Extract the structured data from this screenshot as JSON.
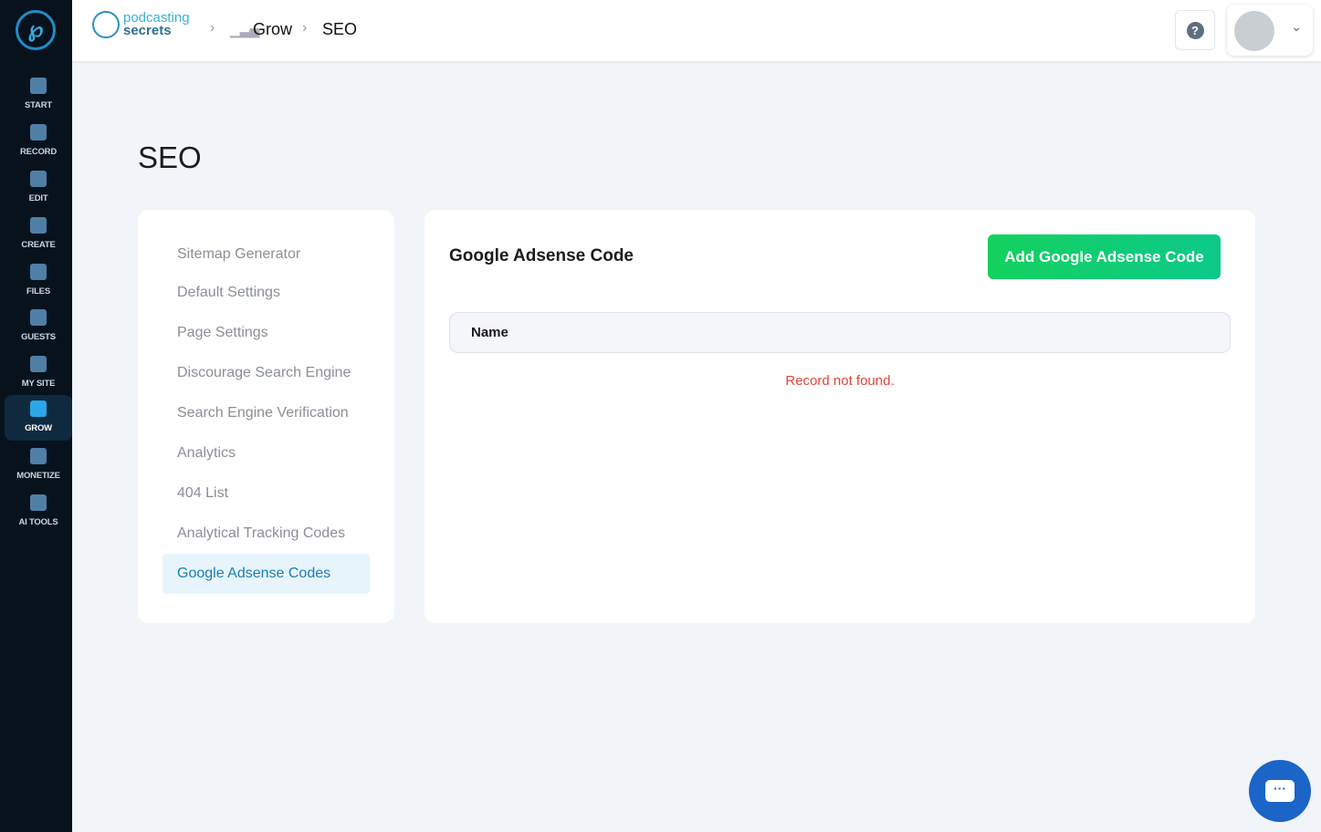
{
  "sidebar": {
    "items": [
      {
        "label": "START"
      },
      {
        "label": "RECORD"
      },
      {
        "label": "EDIT"
      },
      {
        "label": "CREATE"
      },
      {
        "label": "FILES"
      },
      {
        "label": "GUESTS"
      },
      {
        "label": "MY SITE"
      },
      {
        "label": "GROW"
      },
      {
        "label": "MONETIZE"
      },
      {
        "label": "AI TOOLS"
      }
    ],
    "active": "GROW"
  },
  "header": {
    "brand_top": "podcasting",
    "brand_bottom": "secrets",
    "breadcrumb": [
      "Grow",
      "SEO"
    ],
    "help": "?"
  },
  "page": {
    "title": "SEO"
  },
  "menu": {
    "items": [
      {
        "label": "Sitemap Generator"
      },
      {
        "label": "Default Settings"
      },
      {
        "label": "Page Settings"
      },
      {
        "label": "Discourage Search Engine"
      },
      {
        "label": "Search Engine Verification"
      },
      {
        "label": "Analytics"
      },
      {
        "label": "404 List"
      },
      {
        "label": "Analytical Tracking Codes"
      },
      {
        "label": "Google Adsense Codes"
      }
    ]
  },
  "panel": {
    "title": "Google Adsense Code",
    "add_button": "Add Google Adsense Code",
    "column": "Name",
    "empty": "Record not found."
  },
  "colors": {
    "accent": "#1a7fb5",
    "button": "#14d15e",
    "error": "#e2443a",
    "sidebar": "#07121c"
  }
}
